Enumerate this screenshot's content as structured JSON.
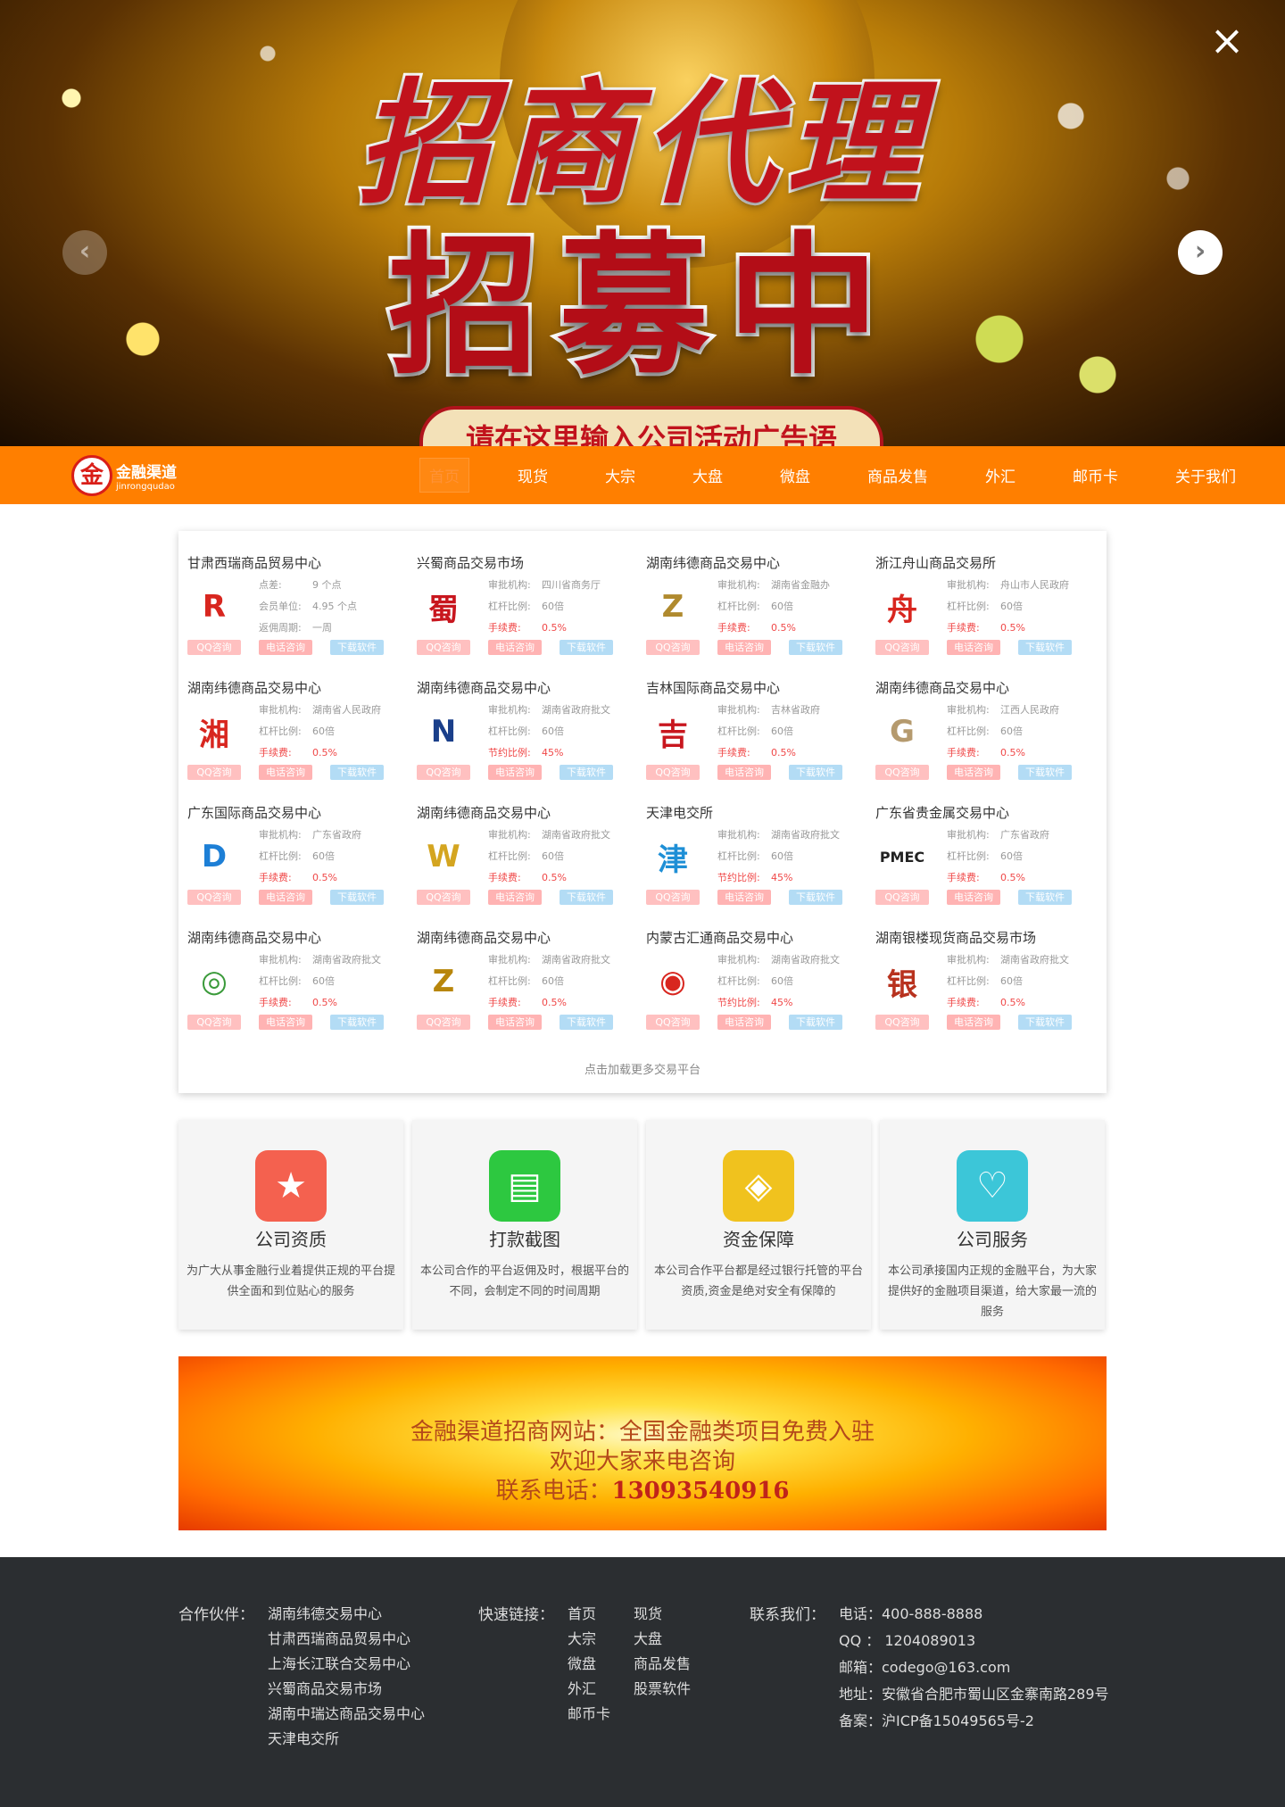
{
  "hero": {
    "title1": "招商代理",
    "title2": "招募中",
    "subtitle": "请在这里输入公司活动广告语",
    "close_icon": "×",
    "prev_icon": "‹",
    "next_icon": "›"
  },
  "nav": {
    "logo_text": "金融渠道",
    "logo_sub": "jinrongqudao",
    "logo_mark": "金",
    "items": [
      {
        "label": "首页"
      },
      {
        "label": "现货"
      },
      {
        "label": "大宗"
      },
      {
        "label": "大盘"
      },
      {
        "label": "微盘"
      },
      {
        "label": "商品发售"
      },
      {
        "label": "外汇"
      },
      {
        "label": "邮币卡"
      },
      {
        "label": "关于我们"
      }
    ]
  },
  "platforms": [
    {
      "name": "甘肃西瑞商品贸易中心",
      "rows": [
        [
          "点差:",
          "9 个点"
        ],
        [
          "会员单位:",
          "4.95 个点"
        ],
        [
          "返佣周期:",
          "一周"
        ]
      ],
      "logo": "R",
      "logo_color": "#d8261f"
    },
    {
      "name": "兴蜀商品交易市场",
      "rows": [
        [
          "审批机构:",
          "四川省商务厅"
        ],
        [
          "杠杆比例:",
          "60倍"
        ],
        [
          "手续费:",
          "0.5%"
        ]
      ],
      "logo": "蜀",
      "logo_color": "#c8161e"
    },
    {
      "name": "湖南纬德商品交易中心",
      "rows": [
        [
          "审批机构:",
          "湖南省金融办"
        ],
        [
          "杠杆比例:",
          "60倍"
        ],
        [
          "手续费:",
          "0.5%"
        ]
      ],
      "logo": "Z",
      "logo_color": "#b08a2e"
    },
    {
      "name": "浙江舟山商品交易所",
      "rows": [
        [
          "审批机构:",
          "舟山市人民政府"
        ],
        [
          "杠杆比例:",
          "60倍"
        ],
        [
          "手续费:",
          "0.5%"
        ]
      ],
      "logo": "舟",
      "logo_color": "#d8261f"
    },
    {
      "name": "湖南纬德商品交易中心",
      "rows": [
        [
          "审批机构:",
          "湖南省人民政府"
        ],
        [
          "杠杆比例:",
          "60倍"
        ],
        [
          "手续费:",
          "0.5%"
        ]
      ],
      "logo": "湘",
      "logo_color": "#d8261f"
    },
    {
      "name": "湖南纬德商品交易中心",
      "rows": [
        [
          "审批机构:",
          "湖南省政府批文"
        ],
        [
          "杠杆比例:",
          "60倍"
        ],
        [
          "节约比例:",
          "45%"
        ]
      ],
      "logo": "N",
      "logo_color": "#1a3f8a"
    },
    {
      "name": "吉林国际商品交易中心",
      "rows": [
        [
          "审批机构:",
          "吉林省政府"
        ],
        [
          "杠杆比例:",
          "60倍"
        ],
        [
          "手续费:",
          "0.5%"
        ]
      ],
      "logo": "吉",
      "logo_color": "#c8161e"
    },
    {
      "name": "湖南纬德商品交易中心",
      "rows": [
        [
          "审批机构:",
          "江西人民政府"
        ],
        [
          "杠杆比例:",
          "60倍"
        ],
        [
          "手续费:",
          "0.5%"
        ]
      ],
      "logo": "G",
      "logo_color": "#b59a6e"
    },
    {
      "name": "广东国际商品交易中心",
      "rows": [
        [
          "审批机构:",
          "广东省政府"
        ],
        [
          "杠杆比例:",
          "60倍"
        ],
        [
          "手续费:",
          "0.5%"
        ]
      ],
      "logo": "D",
      "logo_color": "#1d7fd6"
    },
    {
      "name": "湖南纬德商品交易中心",
      "rows": [
        [
          "审批机构:",
          "湖南省政府批文"
        ],
        [
          "杠杆比例:",
          "60倍"
        ],
        [
          "手续费:",
          "0.5%"
        ]
      ],
      "logo": "W",
      "logo_color": "#d4a520"
    },
    {
      "name": "天津电交所",
      "rows": [
        [
          "审批机构:",
          "湖南省政府批文"
        ],
        [
          "杠杆比例:",
          "60倍"
        ],
        [
          "节约比例:",
          "45%"
        ]
      ],
      "logo": "津",
      "logo_color": "#1e8fd6"
    },
    {
      "name": "广东省贵金属交易中心",
      "rows": [
        [
          "审批机构:",
          "广东省政府"
        ],
        [
          "杠杆比例:",
          "60倍"
        ],
        [
          "手续费:",
          "0.5%"
        ]
      ],
      "logo": "PMEC",
      "logo_color": "#222"
    },
    {
      "name": "湖南纬德商品交易中心",
      "rows": [
        [
          "审批机构:",
          "湖南省政府批文"
        ],
        [
          "杠杆比例:",
          "60倍"
        ],
        [
          "手续费:",
          "0.5%"
        ]
      ],
      "logo": "◎",
      "logo_color": "#3a9a3a"
    },
    {
      "name": "湖南纬德商品交易中心",
      "rows": [
        [
          "审批机构:",
          "湖南省政府批文"
        ],
        [
          "杠杆比例:",
          "60倍"
        ],
        [
          "手续费:",
          "0.5%"
        ]
      ],
      "logo": "Z",
      "logo_color": "#b8860b"
    },
    {
      "name": "内蒙古汇通商品交易中心",
      "rows": [
        [
          "审批机构:",
          "湖南省政府批文"
        ],
        [
          "杠杆比例:",
          "60倍"
        ],
        [
          "节约比例:",
          "45%"
        ]
      ],
      "logo": "◉",
      "logo_color": "#d8261f"
    },
    {
      "name": "湖南银楼现货商品交易市场",
      "rows": [
        [
          "审批机构:",
          "湖南省政府批文"
        ],
        [
          "杠杆比例:",
          "60倍"
        ],
        [
          "手续费:",
          "0.5%"
        ]
      ],
      "logo": "银",
      "logo_color": "#b8321e"
    }
  ],
  "buttons": {
    "qq": "QQ咨询",
    "phone": "电话咨询",
    "download": "下载软件"
  },
  "load_more": "点击加载更多交易平台",
  "features": [
    {
      "title": "公司资质",
      "desc": "为广大从事金融行业着提供正规的平台提供全面和到位贴心的服务",
      "color": "#f4614f",
      "icon": "medal-icon",
      "glyph": "★"
    },
    {
      "title": "打款截图",
      "desc": "本公司合作的平台返佣及时，根据平台的不同，会制定不同的时间周期",
      "color": "#2dc840",
      "icon": "document-clock-icon",
      "glyph": "▤"
    },
    {
      "title": "资金保障",
      "desc": "本公司合作平台都是经过银行托管的平台资质,资金是绝对安全有保障的",
      "color": "#f0c21e",
      "icon": "shield-icon",
      "glyph": "◈"
    },
    {
      "title": "公司服务",
      "desc": "本公司承接国内正规的金融平台，为大家提供好的金融项目渠道，给大家最一流的服务",
      "color": "#3cc6d8",
      "icon": "heart-icon",
      "glyph": "♡"
    }
  ],
  "promo": {
    "line1": "金融渠道招商网站：全国金融类项目免费入驻",
    "line2": "欢迎大家来电咨询",
    "line3_label": "联系电话：",
    "line3_phone": "13093540916"
  },
  "footer": {
    "partners_title": "合作伙伴：",
    "partners": [
      "湖南纬德交易中心",
      "甘肃西瑞商品贸易中心",
      "上海长江联合交易中心",
      "兴蜀商品交易市场",
      "湖南中瑞达商品交易中心",
      "天津电交所"
    ],
    "links_title": "快速链接：",
    "links_col1": [
      "首页",
      "大宗",
      "微盘",
      "外汇",
      "邮币卡"
    ],
    "links_col2": [
      "现货",
      "大盘",
      "商品发售",
      "股票软件"
    ],
    "contact_title": "联系我们：",
    "contact": [
      "电话：400-888-8888",
      "QQ ： 1204089013",
      "邮箱：codego@163.com",
      "地址：安徽省合肥市蜀山区金寨南路289号",
      "备案：沪ICP备15049565号-2"
    ]
  }
}
